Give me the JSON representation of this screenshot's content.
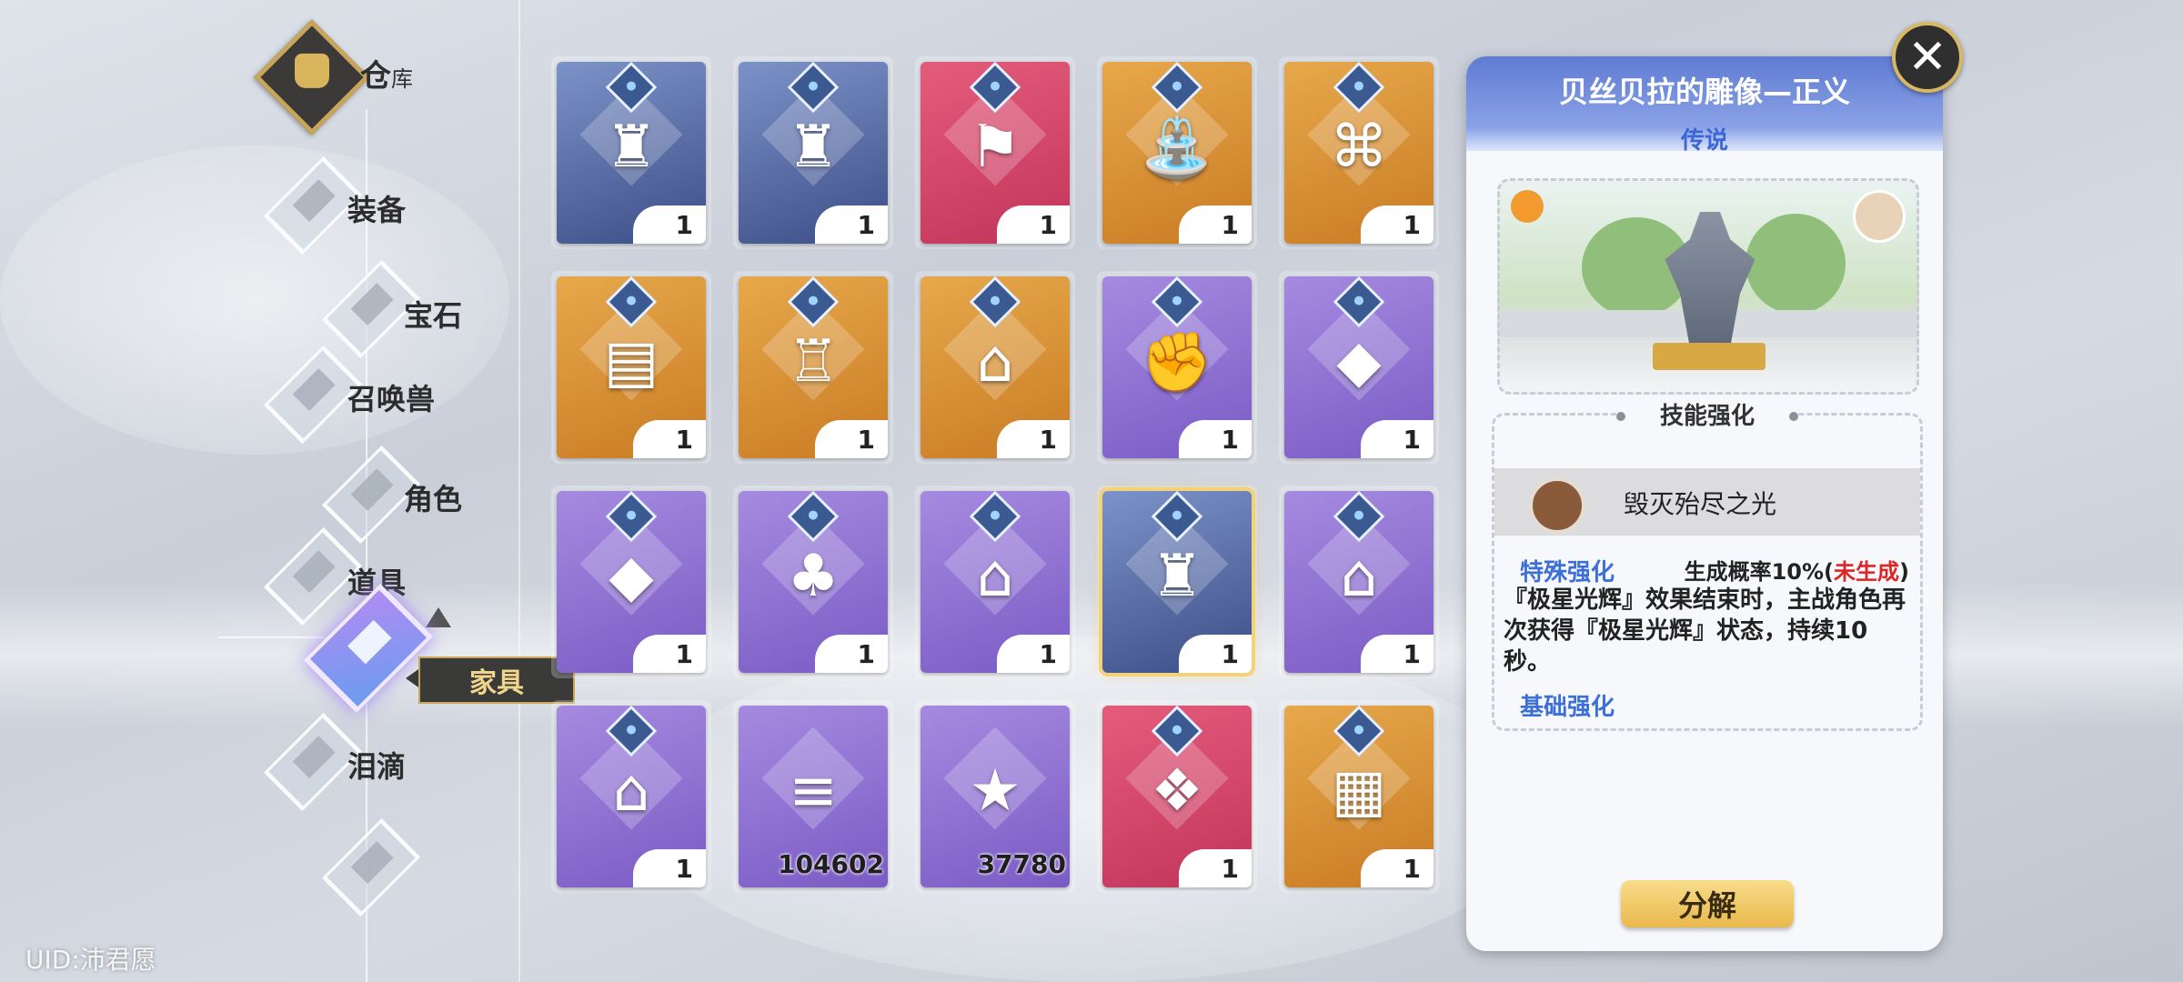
{
  "header": {
    "title_main": "仓",
    "title_sub": "库"
  },
  "nav": {
    "items": [
      {
        "label": "装备"
      },
      {
        "label": "宝石"
      },
      {
        "label": "召唤兽"
      },
      {
        "label": "角色"
      },
      {
        "label": "道具"
      },
      {
        "label": "家具"
      },
      {
        "label": "泪滴"
      }
    ],
    "active_tooltip": "家具"
  },
  "grid": {
    "items": [
      {
        "icon": "statue-icon",
        "count": "1",
        "rarity": "legend"
      },
      {
        "icon": "statue-icon",
        "count": "1",
        "rarity": "legend"
      },
      {
        "icon": "banner-icon",
        "count": "1",
        "rarity": "pink"
      },
      {
        "icon": "fountain-icon",
        "count": "1",
        "rarity": "orange"
      },
      {
        "icon": "frog-fence-icon",
        "count": "1",
        "rarity": "orange"
      },
      {
        "icon": "notice-board-icon",
        "count": "1",
        "rarity": "orange"
      },
      {
        "icon": "lamp-post-icon",
        "count": "1",
        "rarity": "orange"
      },
      {
        "icon": "house-icon",
        "count": "1",
        "rarity": "orange"
      },
      {
        "icon": "fist-statue-icon",
        "count": "1",
        "rarity": "purple"
      },
      {
        "icon": "rock-icon",
        "count": "1",
        "rarity": "purple"
      },
      {
        "icon": "rock-icon",
        "count": "1",
        "rarity": "purple"
      },
      {
        "icon": "tree-icon",
        "count": "1",
        "rarity": "purple"
      },
      {
        "icon": "house-icon",
        "count": "1",
        "rarity": "purple"
      },
      {
        "icon": "statue-icon",
        "count": "1",
        "rarity": "legend"
      },
      {
        "icon": "shop-icon",
        "count": "1",
        "rarity": "purple"
      },
      {
        "icon": "shop-icon",
        "count": "1",
        "rarity": "purple"
      },
      {
        "icon": "logs-icon",
        "count": "104602",
        "rarity": "purple"
      },
      {
        "icon": "star-icon",
        "count": "37780",
        "rarity": "purple"
      },
      {
        "icon": "ice-rock-icon",
        "count": "1",
        "rarity": "pink"
      },
      {
        "icon": "ice-block-icon",
        "count": "1",
        "rarity": "orange"
      }
    ],
    "selected_index": 13
  },
  "detail": {
    "title": "贝丝贝拉的雕像—正义",
    "rarity": "传说",
    "skill_section": "技能强化",
    "skill_name": "毁灭殆尽之光",
    "special_label": "特殊强化",
    "rate_prefix": "生成概率10%(",
    "rate_status": "未生成",
    "rate_suffix": ")",
    "description": "『极星光辉』效果结束时，主战角色再次获得『极星光辉』状态，持续10秒。",
    "base_label": "基础强化",
    "decompose_label": "分解"
  },
  "close_label": "✕",
  "uid": "UID:沛君愿",
  "colors": {
    "accent_gold": "#c9a55a",
    "blue_label": "#3c6fd8",
    "red_status": "#e02424"
  }
}
